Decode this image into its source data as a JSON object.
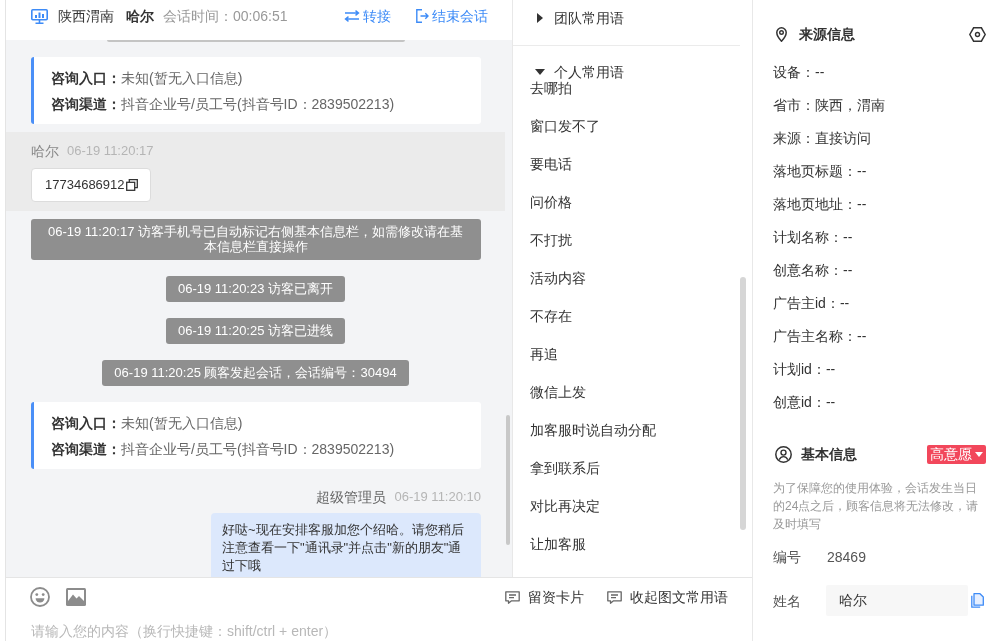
{
  "chat_header": {
    "location": "陕西渭南",
    "visitor": "哈尔",
    "duration": "会话时间：00:06:51",
    "actions": [
      {
        "kind": "transfer",
        "label": "转接"
      },
      {
        "kind": "end",
        "label": "结束会话"
      }
    ]
  },
  "messages": [
    {
      "kind": "info_card",
      "rows": [
        {
          "label": "咨询入口：",
          "value": "未知(暂无入口信息)"
        },
        {
          "label": "咨询渠道：",
          "value": "抖音企业号/员工号(抖音号ID：2839502213)"
        }
      ]
    },
    {
      "kind": "visitor",
      "sender": "哈尔",
      "time": "06-19 11:20:17",
      "text": "17734686912"
    },
    {
      "kind": "system",
      "text": "06-19 11:20:17 访客手机号已自动标记右侧基本信息栏，如需修改请在基本信息栏直接操作"
    },
    {
      "kind": "system",
      "text": "06-19 11:20:23 访客已离开"
    },
    {
      "kind": "system",
      "text": "06-19 11:20:25 访客已进线"
    },
    {
      "kind": "system",
      "text": "06-19 11:20:25 顾客发起会话，会话编号：30494"
    },
    {
      "kind": "info_card",
      "rows": [
        {
          "label": "咨询入口：",
          "value": "未知(暂无入口信息)"
        },
        {
          "label": "咨询渠道：",
          "value": "抖音企业号/员工号(抖音号ID：2839502213)"
        }
      ]
    },
    {
      "kind": "agent",
      "sender": "超级管理员",
      "time": "06-19 11:20:10",
      "text": "好哒~现在安排客服加您个绍哈。请您稍后注意查看一下\"通讯录\"并点击\"新的朋友\"通过下哦"
    }
  ],
  "composer": {
    "placeholder": "请输入您的内容（换行快捷键：shift/ctrl + enter）",
    "tools": [
      "留资卡片",
      "收起图文常用语"
    ]
  },
  "phrases": {
    "groups": [
      {
        "label": "团队常用语",
        "expanded": false
      },
      {
        "label": "个人常用语",
        "expanded": true,
        "items": [
          "去哪拍",
          "窗口发不了",
          "要电话",
          "问价格",
          "不打扰",
          "活动内容",
          "不存在",
          "再追",
          "微信上发",
          "加客服时说自动分配",
          "拿到联系后",
          "对比再决定",
          "让加客服"
        ]
      }
    ]
  },
  "source_info": {
    "title": "来源信息",
    "fields": [
      "设备：--",
      "省市：陕西，渭南",
      "来源：直接访问",
      "落地页标题：--",
      "落地页地址：--",
      "计划名称：--",
      "创意名称：--",
      "广告主id：--",
      "广告主名称：--",
      "计划id：--",
      "创意id：--"
    ]
  },
  "basic_info": {
    "title": "基本信息",
    "intent": "高意愿",
    "notice": "为了保障您的使用体验，会话发生当日的24点之后，顾客信息将无法修改，请及时填写",
    "fields": [
      {
        "kind": "text",
        "label": "编号",
        "value": "28469"
      },
      {
        "kind": "input",
        "label": "姓名",
        "value": "哈尔"
      }
    ]
  }
}
